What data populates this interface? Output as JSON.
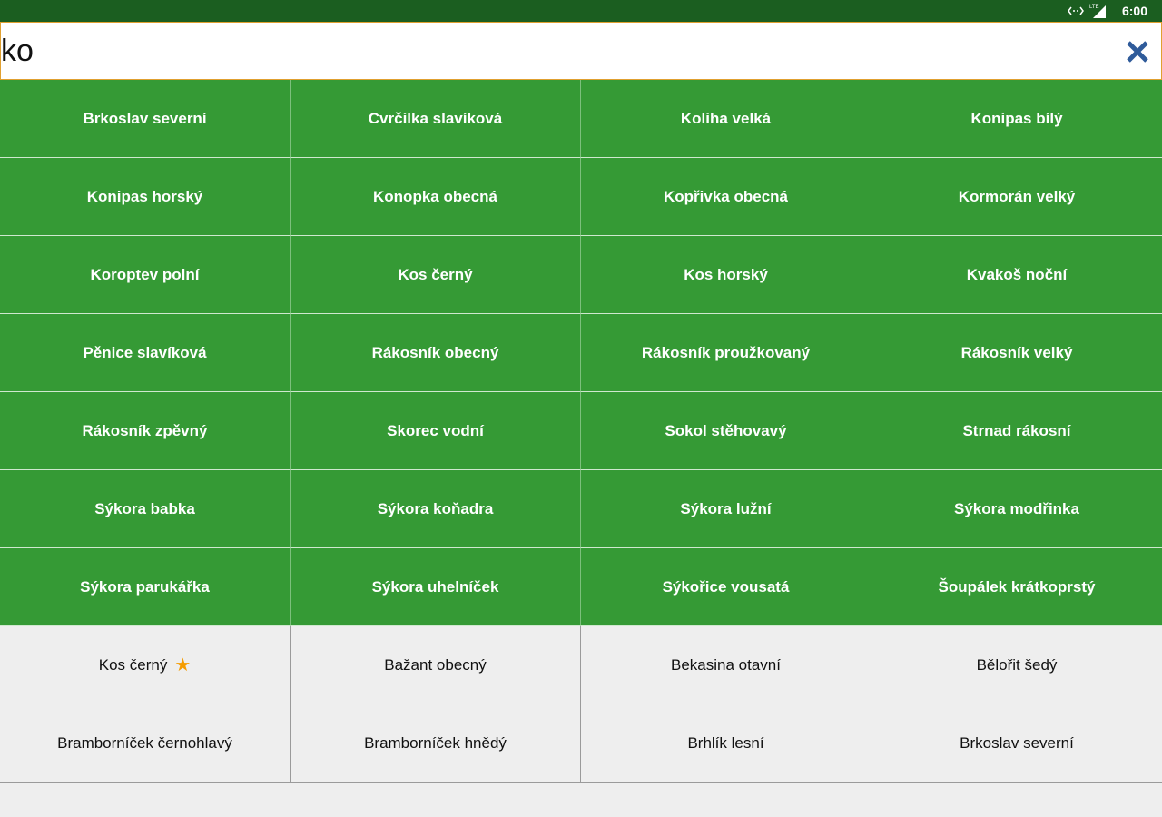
{
  "status_bar": {
    "network_label": "LTE",
    "time": "6:00"
  },
  "search": {
    "value": "ko",
    "placeholder": ""
  },
  "colors": {
    "status_bar": "#1b5e20",
    "match_cell": "#359a35",
    "plain_cell": "#eeeeee",
    "clear_icon": "#2f5b9a",
    "star": "#f59c00"
  },
  "matched_birds": [
    "Brkoslav severní",
    "Cvrčilka slavíková",
    "Koliha velká",
    "Konipas bílý",
    "Konipas horský",
    "Konopka obecná",
    "Kopřivka obecná",
    "Kormorán velký",
    "Koroptev polní",
    "Kos černý",
    "Kos horský",
    "Kvakoš noční",
    "Pěnice slavíková",
    "Rákosník obecný",
    "Rákosník proužkovaný",
    "Rákosník velký",
    "Rákosník zpěvný",
    "Skorec vodní",
    "Sokol stěhovavý",
    "Strnad rákosní",
    "Sýkora babka",
    "Sýkora koňadra",
    "Sýkora lužní",
    "Sýkora modřinka",
    "Sýkora parukářka",
    "Sýkora uhelníček",
    "Sýkořice vousatá",
    "Šoupálek krátkoprstý"
  ],
  "all_birds": [
    {
      "name": "Kos černý",
      "favorite": true
    },
    {
      "name": "Bažant obecný",
      "favorite": false
    },
    {
      "name": "Bekasina otavní",
      "favorite": false
    },
    {
      "name": "Bělořit šedý",
      "favorite": false
    },
    {
      "name": "Bramborníček černohlavý",
      "favorite": false
    },
    {
      "name": "Bramborníček hnědý",
      "favorite": false
    },
    {
      "name": "Brhlík lesní",
      "favorite": false
    },
    {
      "name": "Brkoslav severní",
      "favorite": false
    }
  ]
}
